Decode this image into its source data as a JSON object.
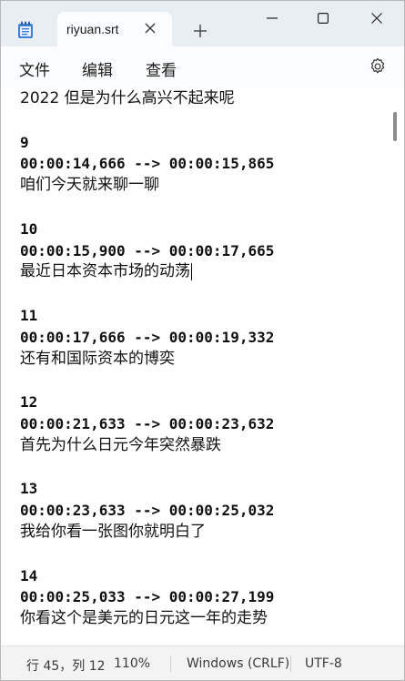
{
  "window": {
    "tab_title": "riyuan.srt"
  },
  "icons": {
    "app": "notepad-icon",
    "tab_close": "close-icon",
    "new_tab": "plus-icon",
    "minimize": "minimize-icon",
    "maximize": "maximize-icon",
    "close": "close-icon",
    "settings": "gear-icon"
  },
  "menu": {
    "file": "文件",
    "edit": "编辑",
    "view": "查看"
  },
  "editor": {
    "lines": [
      {
        "text": "2022 但是为什么高兴不起来呢",
        "kind": "text"
      },
      {
        "text": "",
        "kind": "blank"
      },
      {
        "text": "9",
        "kind": "index"
      },
      {
        "text": "00:00:14,666 --> 00:00:15,865",
        "kind": "time"
      },
      {
        "text": "咱们今天就来聊一聊",
        "kind": "text"
      },
      {
        "text": "",
        "kind": "blank"
      },
      {
        "text": "10",
        "kind": "index"
      },
      {
        "text": "00:00:15,900 --> 00:00:17,665",
        "kind": "time"
      },
      {
        "text": "最近日本资本市场的动荡",
        "kind": "text"
      },
      {
        "text": "",
        "kind": "blank"
      },
      {
        "text": "11",
        "kind": "index"
      },
      {
        "text": "00:00:17,666 --> 00:00:19,332",
        "kind": "time"
      },
      {
        "text": "还有和国际资本的博奕",
        "kind": "text"
      },
      {
        "text": "",
        "kind": "blank"
      },
      {
        "text": "12",
        "kind": "index"
      },
      {
        "text": "00:00:21,633 --> 00:00:23,632",
        "kind": "time"
      },
      {
        "text": "首先为什么日元今年突然暴跌",
        "kind": "text"
      },
      {
        "text": "",
        "kind": "blank"
      },
      {
        "text": "13",
        "kind": "index"
      },
      {
        "text": "00:00:23,633 --> 00:00:25,032",
        "kind": "time"
      },
      {
        "text": "我给你看一张图你就明白了",
        "kind": "text"
      },
      {
        "text": "",
        "kind": "blank"
      },
      {
        "text": "14",
        "kind": "index"
      },
      {
        "text": "00:00:25,033 --> 00:00:27,199",
        "kind": "time"
      },
      {
        "text": "你看这个是美元的日元这一年的走势",
        "kind": "text"
      }
    ],
    "caret_line": 8
  },
  "status": {
    "position": "行 45，列 12",
    "zoom": "110%",
    "line_ending": "Windows (CRLF)",
    "encoding": "UTF-8"
  }
}
